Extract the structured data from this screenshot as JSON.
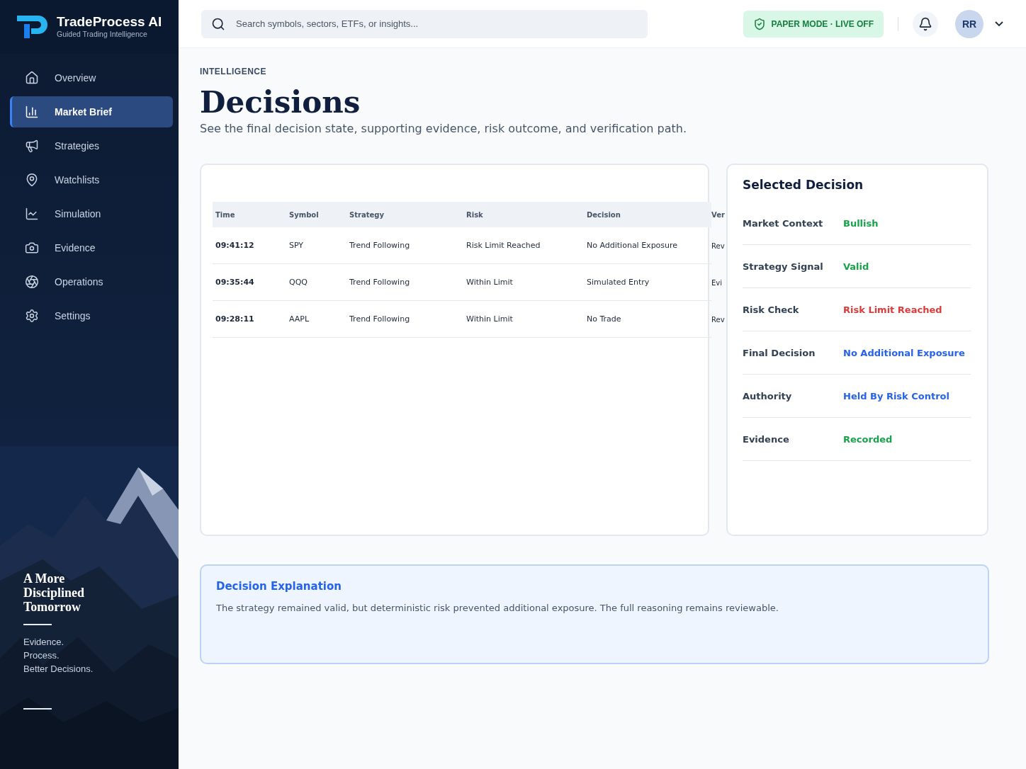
{
  "brand": {
    "name": "TradeProcess AI",
    "tagline": "Guided Trading Intelligence"
  },
  "sidebar": {
    "items": [
      {
        "label": "Overview",
        "selected": false
      },
      {
        "label": "Market Brief",
        "selected": true
      },
      {
        "label": "Strategies",
        "selected": false
      },
      {
        "label": "Watchlists",
        "selected": false
      },
      {
        "label": "Simulation",
        "selected": false
      },
      {
        "label": "Evidence",
        "selected": false
      },
      {
        "label": "Operations",
        "selected": false
      },
      {
        "label": "Settings",
        "selected": false
      }
    ],
    "promo": {
      "heading": "A More Disciplined Tomorrow",
      "lines": [
        "Evidence.",
        "Process.",
        "Better Decisions."
      ]
    }
  },
  "topbar": {
    "search": {
      "placeholder": "Search symbols, sectors, ETFs, or insights..."
    },
    "mode_badge": "PAPER MODE · LIVE OFF",
    "avatar": "RR"
  },
  "page": {
    "eyebrow": "INTELLIGENCE",
    "title": "Decisions",
    "subtitle": "See the final decision state, supporting evidence, risk outcome, and verification path."
  },
  "table": {
    "columns": [
      "Time",
      "Symbol",
      "Strategy",
      "Risk",
      "Decision",
      "Ver"
    ],
    "rows": [
      [
        "09:41:12",
        "SPY",
        "Trend Following",
        "Risk Limit Reached",
        "No Additional Exposure",
        "Rev"
      ],
      [
        "09:35:44",
        "QQQ",
        "Trend Following",
        "Within Limit",
        "Simulated Entry",
        "Evi"
      ],
      [
        "09:28:11",
        "AAPL",
        "Trend Following",
        "Within Limit",
        "No Trade",
        "Rev"
      ]
    ]
  },
  "selected_decision": {
    "title": "Selected Decision",
    "fields": [
      {
        "label": "Market Context",
        "value": "Bullish",
        "color": "#16a34a"
      },
      {
        "label": "Strategy Signal",
        "value": "Valid",
        "color": "#16a34a"
      },
      {
        "label": "Risk Check",
        "value": "Risk Limit Reached",
        "color": "#dc3b3b"
      },
      {
        "label": "Final Decision",
        "value": "No Additional Exposure",
        "color": "#2563eb"
      },
      {
        "label": "Authority",
        "value": "Held By Risk Control",
        "color": "#2563eb"
      },
      {
        "label": "Evidence",
        "value": "Recorded",
        "color": "#16a34a"
      }
    ]
  },
  "explanation": {
    "title": "Decision Explanation",
    "text": "The strategy remained valid, but deterministic risk prevented additional exposure. The full reasoning remains reviewable."
  }
}
